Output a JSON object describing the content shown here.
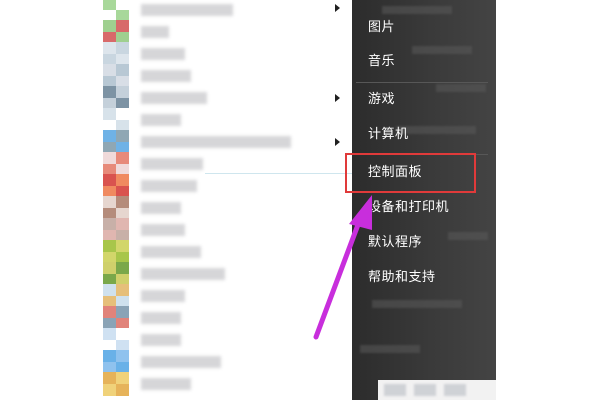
{
  "menu": {
    "items": [
      {
        "label": "图片"
      },
      {
        "label": "音乐"
      },
      {
        "label": "游戏"
      },
      {
        "label": "计算机"
      },
      {
        "label": "控制面板"
      },
      {
        "label": "设备和打印机"
      },
      {
        "label": "默认程序"
      },
      {
        "label": "帮助和支持"
      }
    ]
  },
  "annotation": {
    "highlight_color": "#e03a3a",
    "arrow_color": "#c82edc"
  },
  "program_list": {
    "icon_colors": [
      [
        "#a8d89a",
        "#ffffff"
      ],
      [
        "#9fd08f",
        "#d86a6a"
      ],
      [
        "#dde5ec",
        "#c9d6e0"
      ],
      [
        "#d8dee6",
        "#b8c8d4"
      ],
      [
        "#7d93a4",
        "#c4d0da"
      ],
      [
        "#d7e2ea",
        "#ffffff"
      ],
      [
        "#6fb2e6",
        "#8fa7b4"
      ],
      [
        "#f0dada",
        "#e78a7a"
      ],
      [
        "#d9534f",
        "#f08a60"
      ],
      [
        "#e6d6cf",
        "#b58c7b"
      ],
      [
        "#c8b0a8",
        "#e0b6b0"
      ],
      [
        "#a8c64a",
        "#d2d66a"
      ],
      [
        "#cfd06b",
        "#7aa84a"
      ],
      [
        "#cfe1ee",
        "#e6bf7a"
      ],
      [
        "#e1837a",
        "#8aa3b6"
      ],
      [
        "#cfe1f2",
        "#ffffff"
      ],
      [
        "#69b1e8",
        "#8fc2ee"
      ],
      [
        "#e6b35a",
        "#f0d27a"
      ]
    ]
  }
}
